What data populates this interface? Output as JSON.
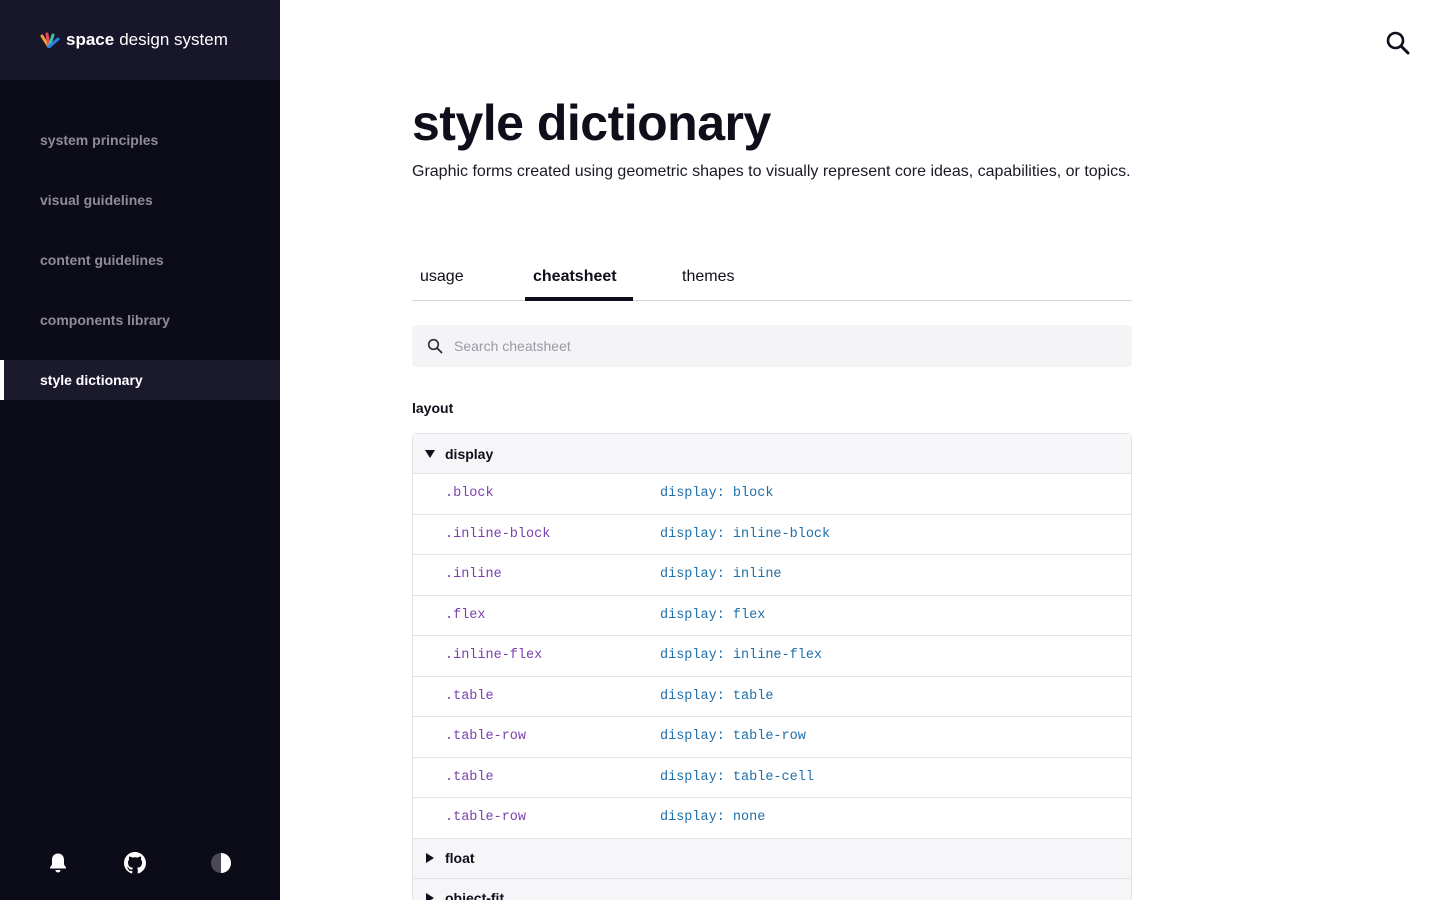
{
  "brand": {
    "name": "space",
    "rest": "design system"
  },
  "sidebar": {
    "items": [
      {
        "label": "system principles",
        "active": false
      },
      {
        "label": "visual guidelines",
        "active": false
      },
      {
        "label": "content guidelines",
        "active": false
      },
      {
        "label": "components library",
        "active": false
      },
      {
        "label": "style dictionary",
        "active": true
      }
    ],
    "footer_icons": [
      "bell-icon",
      "github-icon",
      "theme-toggle-icon"
    ]
  },
  "header": {
    "search_icon": "search-icon"
  },
  "page": {
    "title": "style dictionary",
    "description": "Graphic forms created using geometric shapes to visually represent core ideas, capabilities, or topics."
  },
  "tabs": [
    {
      "label": "usage",
      "active": false
    },
    {
      "label": "cheatsheet",
      "active": true
    },
    {
      "label": "themes",
      "active": false
    }
  ],
  "search": {
    "placeholder": "Search cheatsheet",
    "value": ""
  },
  "section": {
    "title": "layout"
  },
  "groups": {
    "display": {
      "label": "display",
      "expanded": true,
      "rows": [
        {
          "cls": ".block",
          "val": "display: block"
        },
        {
          "cls": ".inline-block",
          "val": "display: inline-block"
        },
        {
          "cls": ".inline",
          "val": "display: inline"
        },
        {
          "cls": ".flex",
          "val": "display: flex"
        },
        {
          "cls": ".inline-flex",
          "val": "display: inline-flex"
        },
        {
          "cls": ".table",
          "val": "display: table"
        },
        {
          "cls": ".table-row",
          "val": "display: table-row"
        },
        {
          "cls": ".table",
          "val": "display: table-cell"
        },
        {
          "cls": ".table-row",
          "val": "display: none"
        }
      ]
    },
    "float": {
      "label": "float",
      "expanded": false
    },
    "object_fit": {
      "label": "object-fit",
      "expanded": false
    }
  },
  "colors": {
    "sidebar_bg": "#0c0b18",
    "brand_bg": "#17162a",
    "class_name": "#7a3fae",
    "property_value": "#1f6fa8"
  }
}
